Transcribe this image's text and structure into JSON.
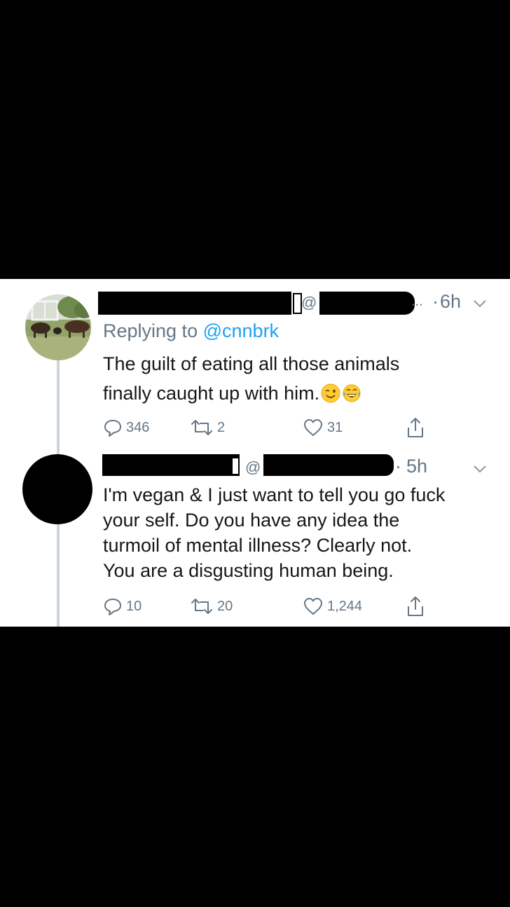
{
  "tweet_1": {
    "at_symbol": "@",
    "ellipsis": "...",
    "separator": "·",
    "time": "6h",
    "reply_prefix": "Replying to",
    "reply_handle": "@cnnbrk",
    "text_lines": [
      "The guilt of eating all those animals",
      "finally caught up with him."
    ],
    "emoji": [
      "winking-face",
      "face-with-tears-of-joy"
    ],
    "replies": "346",
    "retweets": "2",
    "likes": "31"
  },
  "tweet_2": {
    "at_symbol": "@",
    "separator": "·",
    "time": "5h",
    "text_lines": [
      "I'm vegan & I just want to tell you go fuck",
      "your self. Do you have any idea the",
      "turmoil of mental illness?  Clearly not.",
      "You are a disgusting human being."
    ],
    "replies": "10",
    "retweets": "20",
    "likes": "1,244"
  },
  "icons": {
    "reply": "reply-icon",
    "retweet": "retweet-icon",
    "like": "heart-icon",
    "share": "share-icon",
    "menu": "chevron-down-icon"
  },
  "colors": {
    "background": "#000000",
    "card": "#ffffff",
    "text": "#14171a",
    "secondary": "#657786",
    "link": "#1da1f2",
    "thread_line": "#cdd5dc"
  }
}
